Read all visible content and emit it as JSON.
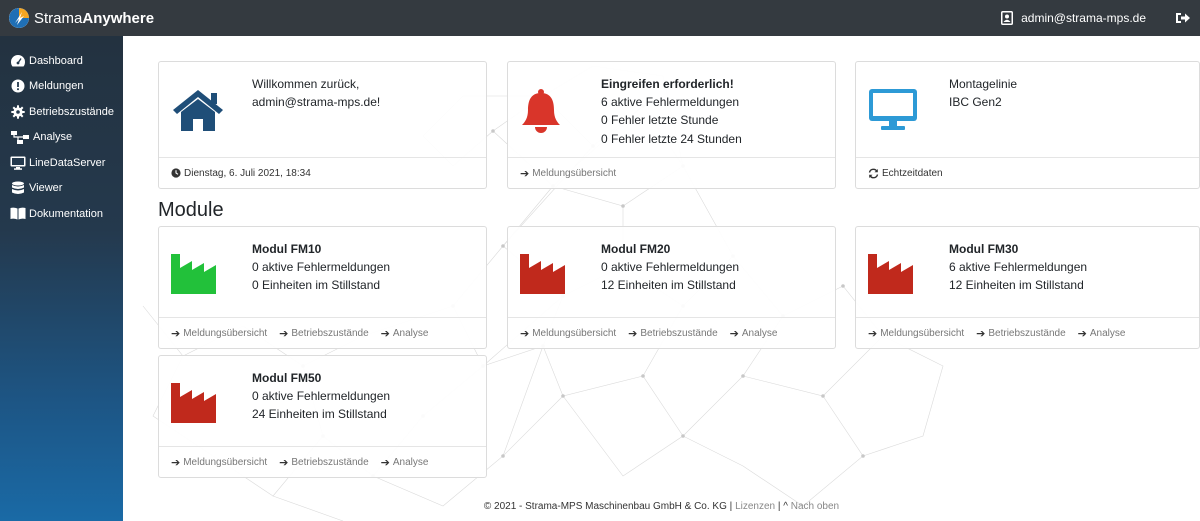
{
  "brand": {
    "name_regular": "Strama",
    "name_bold": "Anywhere"
  },
  "user": {
    "email": "admin@strama-mps.de"
  },
  "sidebar": {
    "items": [
      {
        "label": "Dashboard",
        "icon": "dashboard-icon"
      },
      {
        "label": "Meldungen",
        "icon": "exclamation-circle-icon"
      },
      {
        "label": "Betriebszustände",
        "icon": "gear-icon"
      },
      {
        "label": "Analyse",
        "icon": "sitemap-icon"
      },
      {
        "label": "LineDataServer",
        "icon": "monitor-icon"
      },
      {
        "label": "Viewer",
        "icon": "database-icon"
      },
      {
        "label": "Dokumentation",
        "icon": "book-icon"
      }
    ]
  },
  "welcome": {
    "line1": "Willkommen zurück,",
    "line2": "admin@strama-mps.de!",
    "date": "Dienstag, 6. Juli 2021, 18:34"
  },
  "alert": {
    "title": "Eingreifen erforderlich!",
    "line1": "6 aktive Fehlermeldungen",
    "line2": "0 Fehler letzte Stunde",
    "line3": "0 Fehler letzte 24 Stunden",
    "footer_link": "Meldungsübersicht"
  },
  "line": {
    "line1": "Montagelinie",
    "line2": "IBC Gen2",
    "footer_link": "Echtzeitdaten"
  },
  "modules_title": "Module",
  "link_labels": {
    "messages": "Meldungsübersicht",
    "states": "Betriebszustände",
    "analysis": "Analyse"
  },
  "modules": [
    {
      "name": "Modul FM10",
      "errors": "0 aktive Fehlermeldungen",
      "downtime": "0 Einheiten im Stillstand",
      "color": "#22c13a"
    },
    {
      "name": "Modul FM20",
      "errors": "0 aktive Fehlermeldungen",
      "downtime": "12 Einheiten im Stillstand",
      "color": "#c0291c"
    },
    {
      "name": "Modul FM30",
      "errors": "6 aktive Fehlermeldungen",
      "downtime": "12 Einheiten im Stillstand",
      "color": "#c0291c"
    },
    {
      "name": "Modul FM50",
      "errors": "0 aktive Fehlermeldungen",
      "downtime": "24 Einheiten im Stillstand",
      "color": "#c0291c"
    }
  ],
  "footer": {
    "copyright": "© 2021 - Strama-MPS Maschinenbau GmbH & Co. KG",
    "sep1": "|",
    "licenses": "Lizenzen",
    "sep2": "|",
    "top": "Nach oben"
  },
  "colors": {
    "topbar": "#343a40",
    "house_icon": "#1f4e78",
    "bell_icon": "#d9352a",
    "monitor_icon": "#2d9ad6"
  }
}
